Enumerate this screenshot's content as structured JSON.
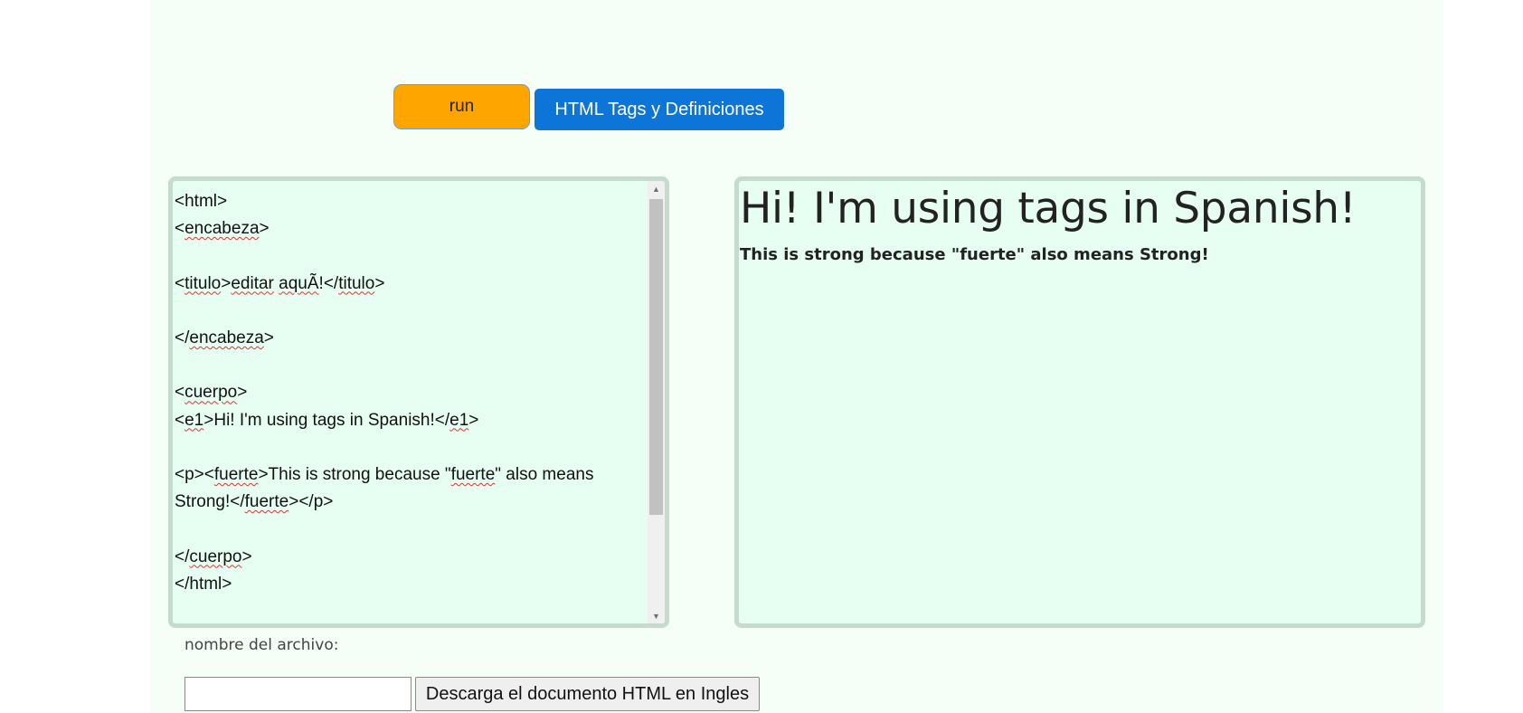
{
  "toolbar": {
    "run_label": "run",
    "tags_label": "HTML Tags y Definiciones"
  },
  "editor": {
    "lines": [
      [
        {
          "t": "<html>"
        }
      ],
      [
        {
          "t": "<"
        },
        {
          "t": "encabeza",
          "sq": true
        },
        {
          "t": ">"
        }
      ],
      [],
      [
        {
          "t": "<"
        },
        {
          "t": "titulo",
          "sq": true
        },
        {
          "t": ">"
        },
        {
          "t": "editar",
          "sq": true
        },
        {
          "t": " "
        },
        {
          "t": "aquÃ",
          "sq": true
        },
        {
          "t": "!</"
        },
        {
          "t": "titulo",
          "sq": true
        },
        {
          "t": ">"
        }
      ],
      [],
      [
        {
          "t": "</"
        },
        {
          "t": "encabeza",
          "sq": true
        },
        {
          "t": ">"
        }
      ],
      [],
      [
        {
          "t": "<"
        },
        {
          "t": "cuerpo",
          "sq": true
        },
        {
          "t": ">"
        }
      ],
      [
        {
          "t": "<"
        },
        {
          "t": "e1",
          "sq": true
        },
        {
          "t": ">Hi! I'm using tags in Spanish!</"
        },
        {
          "t": "e1",
          "sq": true
        },
        {
          "t": ">"
        }
      ],
      [],
      [
        {
          "t": "<p><"
        },
        {
          "t": "fuerte",
          "sq": true
        },
        {
          "t": ">This is strong because \""
        },
        {
          "t": "fuerte",
          "sq": true
        },
        {
          "t": "\" also means"
        }
      ],
      [
        {
          "t": "Strong!</"
        },
        {
          "t": "fuerte",
          "sq": true
        },
        {
          "t": "></p>"
        }
      ],
      [],
      [
        {
          "t": "</"
        },
        {
          "t": "cuerpo",
          "sq": true
        },
        {
          "t": ">"
        }
      ],
      [
        {
          "t": "</html>"
        }
      ]
    ],
    "scroll_up_icon": "triangle-up-icon",
    "scroll_down_icon": "triangle-down-icon"
  },
  "preview": {
    "heading": "Hi! I'm using tags in Spanish!",
    "strong_text": "This is strong because \"fuerte\" also means Strong!"
  },
  "download": {
    "filename_label": "nombre del archivo:",
    "filename_value": "",
    "button_label": "Descarga el documento HTML en Ingles"
  }
}
